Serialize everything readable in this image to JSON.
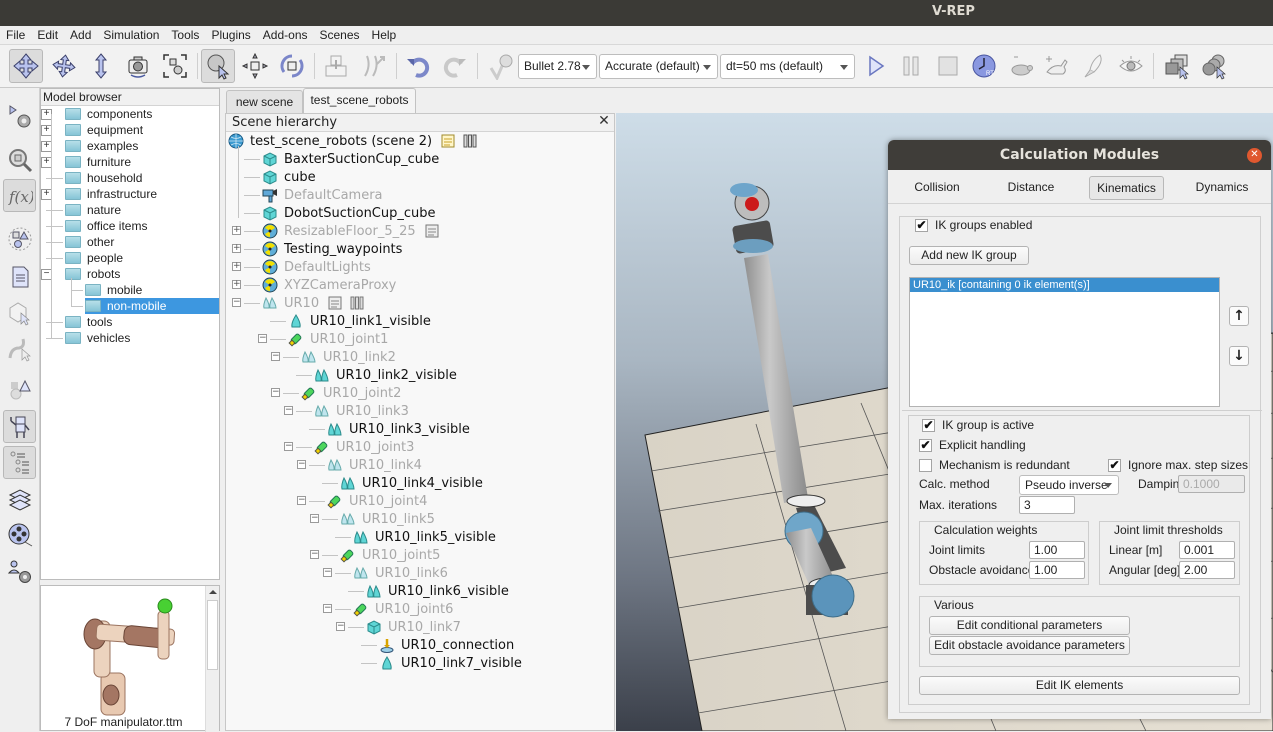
{
  "window": {
    "title": "V-REP"
  },
  "menu": [
    "File",
    "Edit",
    "Add",
    "Simulation",
    "Tools",
    "Plugins",
    "Add-ons",
    "Scenes",
    "Help"
  ],
  "toolbar": {
    "icons": [
      "camera-pan-icon",
      "camera-rotate-icon",
      "camera-shift-icon",
      "camera-angle-icon",
      "fit-to-view-icon",
      "click-selection-icon",
      "object-shift-icon",
      "object-rotate-icon",
      "assemble-icon",
      "transfer-dna-icon",
      "undo-icon",
      "redo-icon",
      "dynamics-content-icon"
    ],
    "physics_engine": "Bullet 2.78",
    "accuracy": "Accurate (default)",
    "timestep": "dt=50 ms (default)",
    "sim_icons": [
      "play-icon",
      "pause-icon",
      "stop-icon",
      "real-time-icon",
      "slower-icon",
      "faster-icon",
      "threaded-rendering-icon",
      "visualization-icon",
      "page-selector-icon",
      "scene-selector-icon"
    ]
  },
  "left_toolbar": [
    "simulation-settings-icon",
    "selection-icon",
    "calculation-modules-icon",
    "collections-icon",
    "scripts-icon",
    "shape-edit-icon",
    "path-edit-icon",
    "primitive-shapes-icon",
    "model-browser-icon",
    "scene-hierarchy-icon",
    "layers-icon",
    "video-recorder-icon",
    "user-settings-icon"
  ],
  "model_browser": {
    "title": "Model browser",
    "items": [
      {
        "label": "components",
        "expandable": true
      },
      {
        "label": "equipment",
        "expandable": true
      },
      {
        "label": "examples",
        "expandable": true
      },
      {
        "label": "furniture",
        "expandable": true
      },
      {
        "label": "household",
        "expandable": false
      },
      {
        "label": "infrastructure",
        "expandable": true
      },
      {
        "label": "nature",
        "expandable": false
      },
      {
        "label": "office items",
        "expandable": false
      },
      {
        "label": "other",
        "expandable": false
      },
      {
        "label": "people",
        "expandable": false
      },
      {
        "label": "robots",
        "expandable": true,
        "expanded": true
      },
      {
        "label": "mobile",
        "child": true
      },
      {
        "label": "non-mobile",
        "child": true,
        "selected": true
      },
      {
        "label": "tools",
        "expandable": false
      },
      {
        "label": "vehicles",
        "expandable": false
      }
    ],
    "preview_caption": "7 DoF manipulator.ttm"
  },
  "scene_tabs": [
    "new scene",
    "test_scene_robots"
  ],
  "scene_hierarchy": {
    "title": "Scene hierarchy",
    "root": "test_scene_robots (scene 2)",
    "items": [
      {
        "label": "BaxterSuctionCup_cube",
        "type": "shape",
        "depth": 1,
        "dim": false
      },
      {
        "label": "cube",
        "type": "shape",
        "depth": 1,
        "dim": false
      },
      {
        "label": "DefaultCamera",
        "type": "camera",
        "depth": 1,
        "dim": true
      },
      {
        "label": "DobotSuctionCup_cube",
        "type": "shape",
        "depth": 1,
        "dim": false
      },
      {
        "label": "ResizableFloor_5_25",
        "type": "model",
        "depth": 1,
        "dim": true
      },
      {
        "label": "Testing_waypoints",
        "type": "model",
        "depth": 1,
        "dim": false
      },
      {
        "label": "DefaultLights",
        "type": "model",
        "depth": 1,
        "dim": true
      },
      {
        "label": "XYZCameraProxy",
        "type": "model",
        "depth": 1,
        "dim": true
      },
      {
        "label": "UR10",
        "type": "multishape",
        "depth": 1,
        "dim": true
      },
      {
        "label": "UR10_link1_visible",
        "type": "shape-single",
        "depth": 2,
        "dim": false
      },
      {
        "label": "UR10_joint1",
        "type": "joint",
        "depth": 2,
        "dim": true
      },
      {
        "label": "UR10_link2",
        "type": "multishape",
        "depth": 3,
        "dim": true
      },
      {
        "label": "UR10_link2_visible",
        "type": "multishape-dark",
        "depth": 4,
        "dim": false
      },
      {
        "label": "UR10_joint2",
        "type": "joint",
        "depth": 3,
        "dim": true
      },
      {
        "label": "UR10_link3",
        "type": "multishape",
        "depth": 4,
        "dim": true
      },
      {
        "label": "UR10_link3_visible",
        "type": "multishape-dark",
        "depth": 5,
        "dim": false
      },
      {
        "label": "UR10_joint3",
        "type": "joint",
        "depth": 4,
        "dim": true
      },
      {
        "label": "UR10_link4",
        "type": "multishape",
        "depth": 5,
        "dim": true
      },
      {
        "label": "UR10_link4_visible",
        "type": "multishape-dark",
        "depth": 6,
        "dim": false
      },
      {
        "label": "UR10_joint4",
        "type": "joint",
        "depth": 5,
        "dim": true
      },
      {
        "label": "UR10_link5",
        "type": "multishape",
        "depth": 6,
        "dim": true
      },
      {
        "label": "UR10_link5_visible",
        "type": "multishape-dark",
        "depth": 7,
        "dim": false
      },
      {
        "label": "UR10_joint5",
        "type": "joint",
        "depth": 6,
        "dim": true
      },
      {
        "label": "UR10_link6",
        "type": "multishape",
        "depth": 7,
        "dim": true
      },
      {
        "label": "UR10_link6_visible",
        "type": "multishape-dark",
        "depth": 8,
        "dim": false
      },
      {
        "label": "UR10_joint6",
        "type": "joint",
        "depth": 7,
        "dim": true
      },
      {
        "label": "UR10_link7",
        "type": "shape",
        "depth": 8,
        "dim": true
      },
      {
        "label": "UR10_connection",
        "type": "dummy",
        "depth": 9,
        "dim": false
      },
      {
        "label": "UR10_link7_visible",
        "type": "shape-single",
        "depth": 9,
        "dim": false
      }
    ]
  },
  "calc_modules": {
    "title": "Calculation Modules",
    "tabs": [
      "Collision",
      "Distance",
      "Kinematics",
      "Dynamics"
    ],
    "active_tab": "Kinematics",
    "ik_groups_enabled": {
      "label": "IK groups enabled",
      "checked": true
    },
    "add_group_button": "Add new IK group",
    "ik_groups": [
      "UR10_ik [containing 0 ik element(s)]"
    ],
    "move_up": "↑",
    "move_down": "↓",
    "ik_group_active": {
      "label": "IK group is active",
      "checked": true
    },
    "explicit_handling": {
      "label": "Explicit handling",
      "checked": true
    },
    "mechanism_redundant": {
      "label": "Mechanism is redundant",
      "checked": false
    },
    "ignore_step_sizes": {
      "label": "Ignore max. step sizes",
      "checked": true
    },
    "calc_method_label": "Calc. method",
    "calc_method": "Pseudo inverse",
    "damping_label": "Damping",
    "damping": "0.1000",
    "max_iterations_label": "Max. iterations",
    "max_iterations": "3",
    "weights": {
      "title": "Calculation weights",
      "joint_limits_label": "Joint limits",
      "joint_limits": "1.00",
      "obstacle_label": "Obstacle avoidance",
      "obstacle": "1.00"
    },
    "thresholds": {
      "title": "Joint limit thresholds",
      "linear_label": "Linear [m]",
      "linear": "0.001",
      "angular_label": "Angular [deg]",
      "angular": "2.00"
    },
    "various": {
      "title": "Various",
      "conditional_button": "Edit conditional parameters",
      "obstacle_button": "Edit obstacle avoidance parameters"
    },
    "edit_elements_button": "Edit IK elements"
  },
  "colors": {
    "selection": "#3d97e0",
    "titlebar": "#3b3a36",
    "close": "#e0582f"
  }
}
